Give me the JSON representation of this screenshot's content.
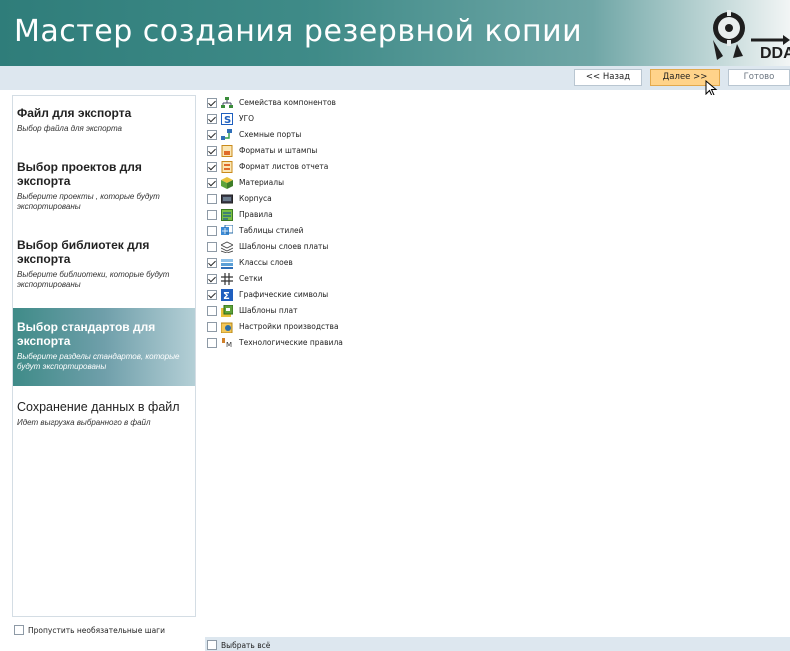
{
  "header": {
    "title": "Мастер создания резервной копии",
    "logo_text": "DDA"
  },
  "toolbar": {
    "back_label": "<< Назад",
    "next_label": "Далее >>",
    "finish_label": "Готово"
  },
  "steps": [
    {
      "title": "Файл для экспорта",
      "desc": "Выбор файла для экспорта",
      "state": "done"
    },
    {
      "title": "Выбор проектов для экспорта",
      "desc": "Выберите проекты , которые будут экспортированы",
      "state": "done"
    },
    {
      "title": "Выбор библиотек для экспорта",
      "desc": "Выберите библиотеки, которые будут экспортированы",
      "state": "done"
    },
    {
      "title": "Выбор стандартов для экспорта",
      "desc": "Выберите разделы стандартов, которые будут экспортированы",
      "state": "active"
    },
    {
      "title": "Сохранение данных в файл",
      "desc": "Идет выгрузка выбранного в файл",
      "state": "pending"
    }
  ],
  "skip_optional": {
    "label": "Пропустить необязательные шаги",
    "checked": false
  },
  "items": [
    {
      "label": "Семейства компонентов",
      "checked": true,
      "icon": "component-family-icon"
    },
    {
      "label": "УГО",
      "checked": true,
      "icon": "symbol-icon"
    },
    {
      "label": "Схемные порты",
      "checked": true,
      "icon": "schematic-port-icon"
    },
    {
      "label": "Форматы и штампы",
      "checked": true,
      "icon": "format-stamp-icon"
    },
    {
      "label": "Формат листов отчета",
      "checked": true,
      "icon": "report-sheet-icon"
    },
    {
      "label": "Материалы",
      "checked": true,
      "icon": "materials-icon"
    },
    {
      "label": "Корпуса",
      "checked": false,
      "icon": "package-icon"
    },
    {
      "label": "Правила",
      "checked": false,
      "icon": "rules-icon"
    },
    {
      "label": "Таблицы стилей",
      "checked": false,
      "icon": "style-table-icon"
    },
    {
      "label": "Шаблоны слоев платы",
      "checked": false,
      "icon": "layer-template-icon"
    },
    {
      "label": "Классы слоев",
      "checked": true,
      "icon": "layer-class-icon"
    },
    {
      "label": "Сетки",
      "checked": true,
      "icon": "grid-icon"
    },
    {
      "label": "Графические символы",
      "checked": true,
      "icon": "graphic-symbol-icon"
    },
    {
      "label": "Шаблоны плат",
      "checked": false,
      "icon": "board-template-icon"
    },
    {
      "label": "Настройки производства",
      "checked": false,
      "icon": "production-settings-icon"
    },
    {
      "label": "Технологические правила",
      "checked": false,
      "icon": "tech-rules-icon"
    }
  ],
  "select_all": {
    "label": "Выбрать всё",
    "checked": false
  }
}
